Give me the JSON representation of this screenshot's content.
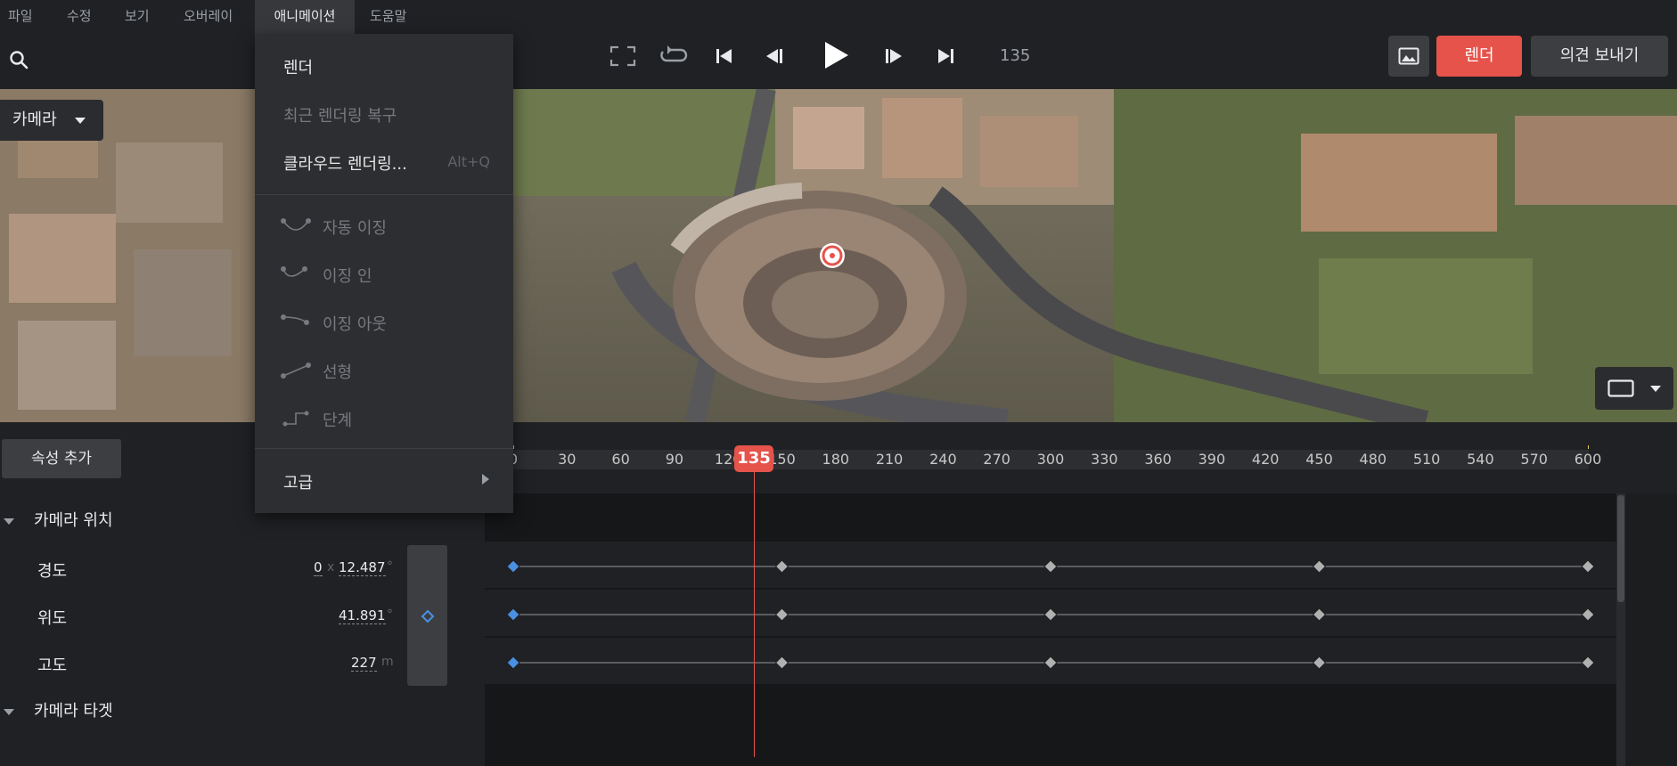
{
  "menubar": {
    "items": [
      {
        "label": "파일"
      },
      {
        "label": "수정"
      },
      {
        "label": "보기"
      },
      {
        "label": "오버레이"
      },
      {
        "label": "애니메이션"
      },
      {
        "label": "도움말"
      }
    ],
    "active": "애니메이션"
  },
  "toolbar": {
    "frame": "135",
    "render_label": "렌더",
    "feedback_label": "의견 보내기"
  },
  "viewport": {
    "camera_dropdown": "카메라"
  },
  "animation_menu": {
    "render": "렌더",
    "restore_recent": "최근 렌더링 복구",
    "cloud_render": "클라우드 렌더링...",
    "cloud_shortcut": "Alt+Q",
    "auto_ease": "자동 이징",
    "ease_in": "이징 인",
    "ease_out": "이징 아웃",
    "linear": "선형",
    "step": "단계",
    "advanced": "고급"
  },
  "properties": {
    "add_label": "속성 추가",
    "camera_position": {
      "title": "카메라 위치",
      "longitude": {
        "label": "경도",
        "prefix": "0",
        "sep": "x",
        "value": "12.487",
        "unit": "°"
      },
      "latitude": {
        "label": "위도",
        "value": "41.891",
        "unit": "°"
      },
      "altitude": {
        "label": "고도",
        "value": "227",
        "unit": "m"
      }
    },
    "camera_target": {
      "title": "카메라 타겟"
    }
  },
  "timeline": {
    "ticks": [
      "0",
      "30",
      "60",
      "90",
      "120",
      "150",
      "180",
      "210",
      "240",
      "270",
      "300",
      "330",
      "360",
      "390",
      "420",
      "450",
      "480",
      "510",
      "540",
      "570",
      "600"
    ],
    "max_frame": 600,
    "playhead": "135",
    "playhead_frame": 135
  },
  "colors": {
    "accent": "#e5534b",
    "keyframe_active": "#4a90e2",
    "keyframe": "#b0b0b0"
  }
}
